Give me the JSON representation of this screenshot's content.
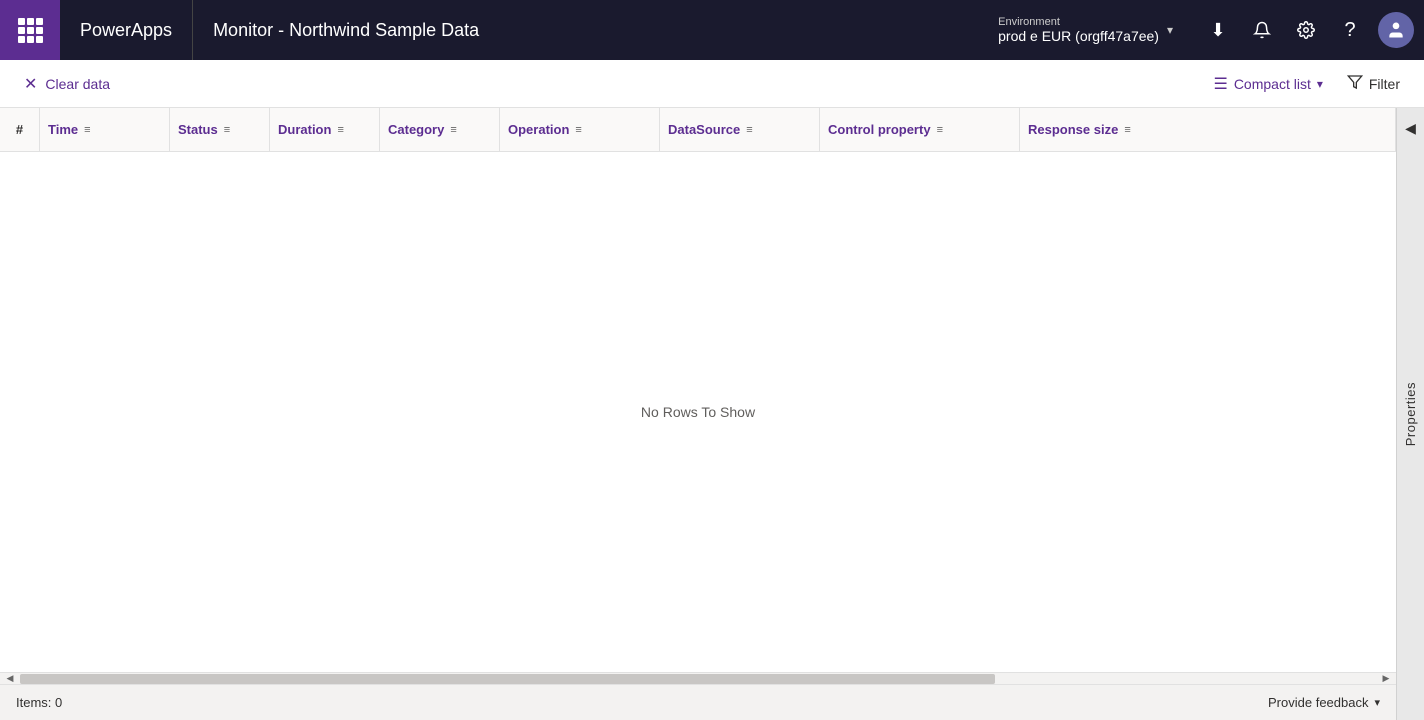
{
  "nav": {
    "app_name": "PowerApps",
    "page_title": "Monitor - Northwind Sample Data",
    "environment_label": "Environment",
    "environment_name": "prod e EUR (orgff47a7ee)",
    "download_icon": "⬇",
    "notification_icon": "🔔",
    "settings_icon": "⚙",
    "help_icon": "?",
    "avatar_icon": "👤"
  },
  "toolbar": {
    "clear_data_label": "Clear data",
    "compact_list_label": "Compact list",
    "filter_label": "Filter"
  },
  "table": {
    "columns": [
      {
        "id": "hash",
        "label": "#"
      },
      {
        "id": "time",
        "label": "Time"
      },
      {
        "id": "status",
        "label": "Status"
      },
      {
        "id": "duration",
        "label": "Duration"
      },
      {
        "id": "category",
        "label": "Category"
      },
      {
        "id": "operation",
        "label": "Operation"
      },
      {
        "id": "datasource",
        "label": "DataSource"
      },
      {
        "id": "control-prop",
        "label": "Control property"
      },
      {
        "id": "response-size",
        "label": "Response size"
      }
    ],
    "empty_message": "No Rows To Show"
  },
  "status_bar": {
    "items_label": "Items: 0",
    "feedback_label": "Provide feedback"
  },
  "properties_panel": {
    "label": "Properties"
  }
}
